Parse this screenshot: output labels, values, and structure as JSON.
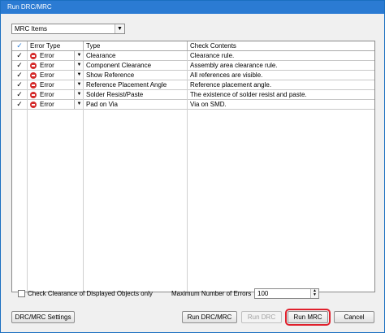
{
  "window": {
    "title": "Run DRC/MRC"
  },
  "filter": {
    "selected": "MRC Items"
  },
  "table": {
    "headers": {
      "check": "✓",
      "error_type": "Error Type",
      "type": "Type",
      "contents": "Check Contents"
    },
    "rows": [
      {
        "checked": "✓",
        "error_type": "Error",
        "type": "Clearance",
        "contents": "Clearance rule."
      },
      {
        "checked": "✓",
        "error_type": "Error",
        "type": "Component Clearance",
        "contents": "Assembly area clearance rule."
      },
      {
        "checked": "✓",
        "error_type": "Error",
        "type": "Show Reference",
        "contents": "All references are visible."
      },
      {
        "checked": "✓",
        "error_type": "Error",
        "type": "Reference Placement Angle",
        "contents": "Reference placement angle."
      },
      {
        "checked": "✓",
        "error_type": "Error",
        "type": "Solder Resist/Paste",
        "contents": "The existence of solder resist and paste."
      },
      {
        "checked": "✓",
        "error_type": "Error",
        "type": "Pad on Via",
        "contents": "Via on SMD."
      }
    ]
  },
  "options": {
    "check_displayed_label": "Check Clearance of Displayed Objects only",
    "max_errors_label": "Maximum Number of Errors",
    "max_errors_value": "100"
  },
  "buttons": {
    "settings": "DRC/MRC Settings",
    "run_drc_mrc": "Run DRC/MRC",
    "run_drc": "Run DRC",
    "run_mrc": "Run MRC",
    "cancel": "Cancel"
  },
  "icons": {
    "error": "error-icon",
    "dropdown": "chevron-down-icon",
    "check": "checkmark-icon"
  },
  "colors": {
    "titlebar": "#2b7bd3",
    "error": "#d42a2a",
    "highlight": "#e0202c"
  }
}
